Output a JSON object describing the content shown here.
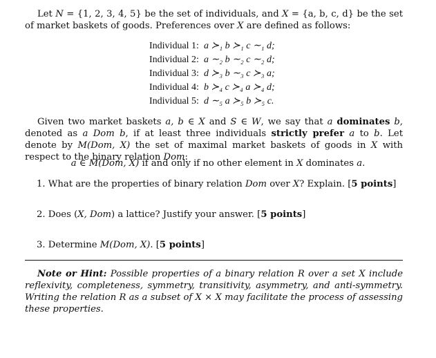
{
  "intro": {
    "line1_a": "Let ",
    "N": "N",
    "eq1": " = {1, 2, 3, 4, 5} be the set of individuals, and ",
    "X": "X",
    "eq2": " = {a, b, c, d} be the set of market baskets of goods. Preferences over ",
    "X2": "X",
    "tail": " are defined as follows:"
  },
  "preferences": [
    {
      "label": "Individual 1:",
      "relation": "a ≻₁ b ≻₁ c ∼₁ d;"
    },
    {
      "label": "Individual 2:",
      "relation": "a ∼₂ b ∼₂ c ∼₂ d;"
    },
    {
      "label": "Individual 3:",
      "relation": "d ≻₃ b ∼₃ c ≻₃ a;"
    },
    {
      "label": "Individual 4:",
      "relation": "b ≻₄ c ≻₄ a ≻₄ d;"
    },
    {
      "label": "Individual 5:",
      "relation": "d ∼₅ a ≻₅ b ≻₅ c."
    }
  ],
  "definition": {
    "p1": "Given two market baskets ",
    "m1": "a, b ∈ X",
    "p2": " and ",
    "m2": "S ∈ W",
    "p3": ", we say that ",
    "m3": "a",
    "b1": "dominates",
    "m4": "b",
    "p4": ", denoted as ",
    "m5": "a Dom b",
    "p5": ", if at least three individuals ",
    "b2": "strictly prefer",
    "m6": "a",
    "p6": " to ",
    "m7": "b",
    "p7": ". Let denote by ",
    "m8": "M(Dom, X)",
    "p8": " the set of maximal market baskets of goods in ",
    "m9": "X",
    "p9": " with respect to the binary relation ",
    "m10": "Dom",
    "p10": ":"
  },
  "centered": {
    "m1": "a ∈ M(Dom, X)",
    "t1": " if and only if no other element in ",
    "m2": "X",
    "t2": " dominates ",
    "m3": "a",
    "t3": "."
  },
  "questions": [
    {
      "num": "1.",
      "pre": "What are the properties of binary relation ",
      "math": "Dom",
      "mid": " over ",
      "math2": "X",
      "post": "? Explain. [",
      "points": "5 points",
      "close": "]"
    },
    {
      "num": "2.",
      "pre": "Does (",
      "math": "X, Dom",
      "mid": ") a lattice? Justify your answer. [",
      "math2": "",
      "post": "",
      "points": "5 points",
      "close": "]"
    },
    {
      "num": "3.",
      "pre": "Determine ",
      "math": "M(Dom, X)",
      "mid": ". [",
      "math2": "",
      "post": "",
      "points": "5 points",
      "close": "]"
    }
  ],
  "hint": {
    "label": "Note or Hint:",
    "t1": " Possible properties of a binary relation R over a set X include reflexivity, completeness, symmetry, transitivity, asymmetry, and anti-symmetry. Writing the relation R as a subset of X × X may facilitate the process of assessing these properties."
  }
}
